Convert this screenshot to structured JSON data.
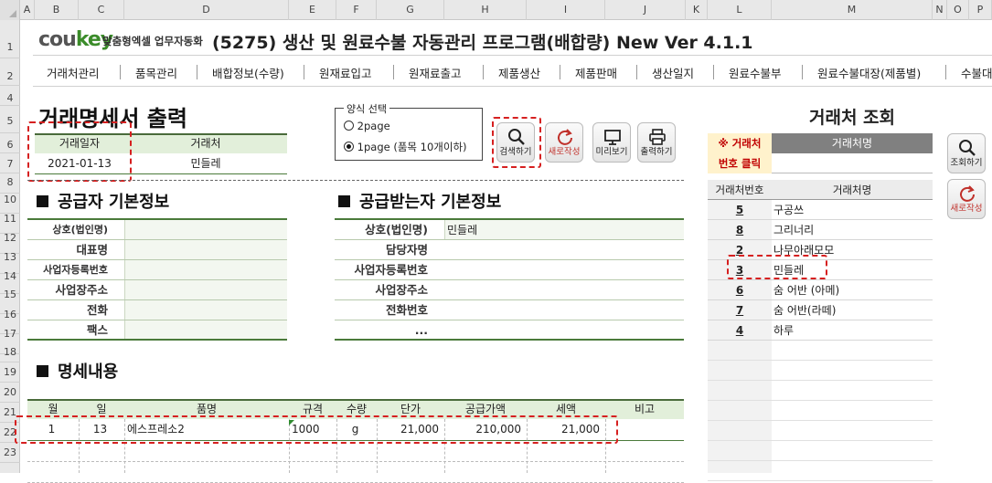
{
  "columns": [
    "A",
    "B",
    "C",
    "D",
    "E",
    "F",
    "G",
    "H",
    "I",
    "J",
    "K",
    "L",
    "M",
    "N",
    "O",
    "P"
  ],
  "rows": [
    "1",
    "2",
    "4",
    "5",
    "6",
    "7",
    "8",
    "10",
    "11",
    "12",
    "13",
    "14",
    "15",
    "16",
    "17",
    "18",
    "19",
    "20",
    "21",
    "22",
    "23"
  ],
  "header": {
    "logo_a": "cou",
    "logo_b": "key",
    "logo_sub": "맞춤형엑셀 업무자동화",
    "title": "(5275) 생산 및 원료수불 자동관리 프로그램(배합량) New Ver 4.1.1"
  },
  "menu": [
    "거래처관리",
    "품목관리",
    "배합정보(수량)",
    "원재료입고",
    "원재료출고",
    "제품생산",
    "제품판매",
    "생산일지",
    "원료수불부",
    "원료수불대장(제품별)",
    "수불대"
  ],
  "page_title": "거래명세서 출력",
  "date_box": {
    "label_date": "거래일자",
    "label_client": "거래처",
    "date": "2021-01-13",
    "client": "민들레"
  },
  "format": {
    "legend": "양식 선택",
    "option1": "2page",
    "option2": "1page (품목 10개이하)",
    "selected": "1page"
  },
  "buttons": {
    "search": "검색하기",
    "new": "새로작성",
    "preview": "미리보기",
    "print": "출력하기",
    "lookup": "조회하기",
    "new2": "새로작성"
  },
  "supplier": {
    "heading": "공급자 기본정보",
    "labels": [
      "상호(법인명)",
      "대표명",
      "사업자등록번호",
      "사업장주소",
      "전화",
      "팩스"
    ]
  },
  "receiver": {
    "heading": "공급받는자 기본정보",
    "labels": [
      "상호(법인명)",
      "담당자명",
      "사업자등록번호",
      "사업장주소",
      "전화번호",
      "..."
    ],
    "values": [
      "민들레",
      "",
      "",
      "",
      "",
      ""
    ]
  },
  "detail": {
    "heading": "명세내용",
    "columns": [
      "월",
      "일",
      "품명",
      "규격",
      "수량",
      "단가",
      "공급가액",
      "세액",
      "비고"
    ],
    "rows": [
      {
        "month": "1",
        "day": "13",
        "name": "에스프레소2",
        "spec": "1000",
        "unit": "g",
        "price": "21,000",
        "supply": "210,000",
        "tax": "21,000",
        "note": ""
      }
    ]
  },
  "lookup": {
    "heading": "거래처 조회",
    "hint1": "※ 거래처",
    "hint2": "번호 클릭",
    "name_label": "거래처명",
    "col_no": "거래처번호",
    "col_name": "거래처명",
    "items": [
      {
        "no": "5",
        "name": "구공쓰"
      },
      {
        "no": "8",
        "name": "그리너리"
      },
      {
        "no": "2",
        "name": "나무아래모모"
      },
      {
        "no": "3",
        "name": "민들레"
      },
      {
        "no": "6",
        "name": "숨 어반 (아메)"
      },
      {
        "no": "7",
        "name": "숨 어반(라떼)"
      },
      {
        "no": "4",
        "name": "하루"
      }
    ]
  },
  "colors": {
    "accent_green": "#4a7a3a",
    "header_green": "#e2efda",
    "highlight_red": "#d62020",
    "hint_yellow": "#fff2cc"
  }
}
